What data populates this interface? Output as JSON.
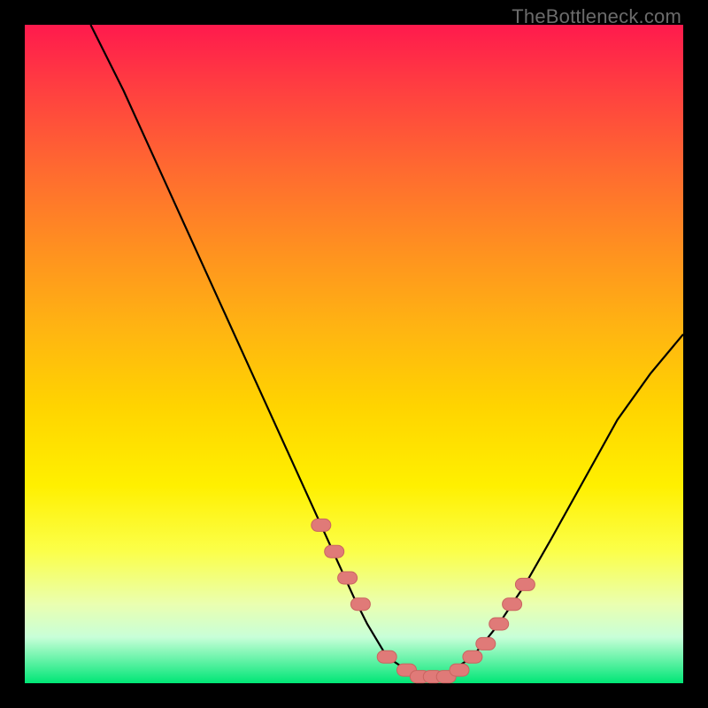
{
  "attribution": "TheBottleneck.com",
  "colors": {
    "page_bg": "#000000",
    "gradient_top": "#ff1a4d",
    "gradient_bottom": "#00e676",
    "curve": "#000000",
    "marker_fill": "#e07a78",
    "marker_stroke": "#c96460"
  },
  "chart_data": {
    "type": "line",
    "title": "",
    "xlabel": "",
    "ylabel": "",
    "xlim": [
      0,
      100
    ],
    "ylim": [
      0,
      100
    ],
    "series": [
      {
        "name": "bottleneck-curve",
        "x": [
          10,
          15,
          20,
          25,
          30,
          35,
          40,
          45,
          50,
          52,
          55,
          58,
          60,
          62,
          65,
          68,
          72,
          76,
          80,
          85,
          90,
          95,
          100
        ],
        "values": [
          100,
          90,
          79,
          68,
          57,
          46,
          35,
          24,
          13,
          9,
          4,
          2,
          1,
          1,
          2,
          4,
          9,
          15,
          22,
          31,
          40,
          47,
          53
        ]
      }
    ],
    "markers": {
      "name": "highlighted-range",
      "x": [
        45,
        47,
        49,
        51,
        55,
        58,
        60,
        62,
        64,
        66,
        68,
        70,
        72,
        74,
        76
      ],
      "values": [
        24,
        20,
        16,
        12,
        4,
        2,
        1,
        1,
        1,
        2,
        4,
        6,
        9,
        12,
        15
      ]
    }
  }
}
